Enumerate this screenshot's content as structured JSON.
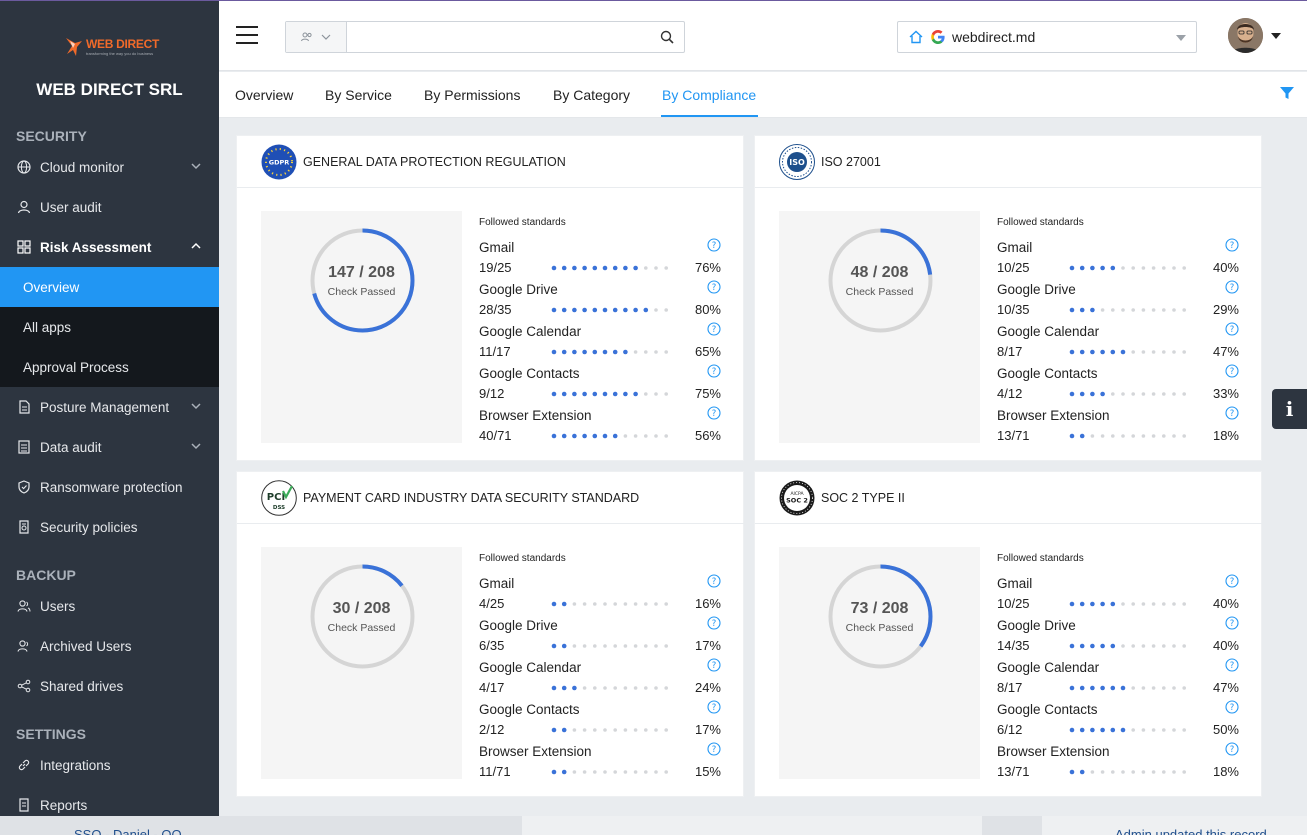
{
  "company": "WEB DIRECT SRL",
  "logo": {
    "wordmark": "WEB DIRECT",
    "tagline": "transforming the way you do business"
  },
  "sidebar": {
    "sections": [
      "SECURITY",
      "BACKUP",
      "SETTINGS"
    ],
    "items": [
      {
        "label": "Cloud monitor",
        "icon": "globe-icon"
      },
      {
        "label": "User audit",
        "icon": "user-icon"
      },
      {
        "label": "Risk Assessment",
        "icon": "grid-icon"
      },
      {
        "label": "Overview"
      },
      {
        "label": "All apps"
      },
      {
        "label": "Approval Process"
      },
      {
        "label": "Posture Management",
        "icon": "document-icon"
      },
      {
        "label": "Data audit",
        "icon": "list-icon"
      },
      {
        "label": "Ransomware protection",
        "icon": "shield-icon"
      },
      {
        "label": "Security policies",
        "icon": "policy-icon"
      },
      {
        "label": "Users",
        "icon": "users-icon"
      },
      {
        "label": "Archived Users",
        "icon": "archived-users-icon"
      },
      {
        "label": "Shared drives",
        "icon": "share-icon"
      },
      {
        "label": "Integrations",
        "icon": "link-icon"
      },
      {
        "label": "Reports",
        "icon": "report-icon"
      }
    ]
  },
  "header": {
    "search_value": "",
    "domain": "webdirect.md"
  },
  "tabs": [
    "Overview",
    "By Service",
    "By Permissions",
    "By Category",
    "By Compliance"
  ],
  "active_tab": "By Compliance",
  "colors": {
    "accent": "#2196f3",
    "sidebar": "#2d3540",
    "progress": "#3a72d8",
    "track": "#d5d5d5"
  },
  "cards": [
    {
      "title": "GENERAL DATA PROTECTION REGULATION",
      "badge": "GDPR",
      "gauge": {
        "text": "147 / 208",
        "label": "Check Passed",
        "passed": 147,
        "total": 208
      },
      "std_head": "Followed standards",
      "services": [
        {
          "name": "Gmail",
          "count": "19/25",
          "pct": "76%",
          "value": 0.76
        },
        {
          "name": "Google Drive",
          "count": "28/35",
          "pct": "80%",
          "value": 0.8
        },
        {
          "name": "Google Calendar",
          "count": "11/17",
          "pct": "65%",
          "value": 0.65
        },
        {
          "name": "Google Contacts",
          "count": "9/12",
          "pct": "75%",
          "value": 0.75
        },
        {
          "name": "Browser Extension",
          "count": "40/71",
          "pct": "56%",
          "value": 0.56
        }
      ]
    },
    {
      "title": "ISO 27001",
      "badge": "ISO",
      "gauge": {
        "text": "48 / 208",
        "label": "Check Passed",
        "passed": 48,
        "total": 208
      },
      "std_head": "Followed standards",
      "services": [
        {
          "name": "Gmail",
          "count": "10/25",
          "pct": "40%",
          "value": 0.4
        },
        {
          "name": "Google Drive",
          "count": "10/35",
          "pct": "29%",
          "value": 0.29
        },
        {
          "name": "Google Calendar",
          "count": "8/17",
          "pct": "47%",
          "value": 0.47
        },
        {
          "name": "Google Contacts",
          "count": "4/12",
          "pct": "33%",
          "value": 0.33
        },
        {
          "name": "Browser Extension",
          "count": "13/71",
          "pct": "18%",
          "value": 0.18
        }
      ]
    },
    {
      "title": "PAYMENT CARD INDUSTRY DATA SECURITY STANDARD",
      "badge": "PCI DSS",
      "gauge": {
        "text": "30 / 208",
        "label": "Check Passed",
        "passed": 30,
        "total": 208
      },
      "std_head": "Followed standards",
      "services": [
        {
          "name": "Gmail",
          "count": "4/25",
          "pct": "16%",
          "value": 0.16
        },
        {
          "name": "Google Drive",
          "count": "6/35",
          "pct": "17%",
          "value": 0.17
        },
        {
          "name": "Google Calendar",
          "count": "4/17",
          "pct": "24%",
          "value": 0.24
        },
        {
          "name": "Google Contacts",
          "count": "2/12",
          "pct": "17%",
          "value": 0.17
        },
        {
          "name": "Browser Extension",
          "count": "11/71",
          "pct": "15%",
          "value": 0.15
        }
      ]
    },
    {
      "title": "SOC 2 TYPE II",
      "badge": "AICPA SOC 2",
      "gauge": {
        "text": "73 / 208",
        "label": "Check Passed",
        "passed": 73,
        "total": 208
      },
      "std_head": "Followed standards",
      "services": [
        {
          "name": "Gmail",
          "count": "10/25",
          "pct": "40%",
          "value": 0.4
        },
        {
          "name": "Google Drive",
          "count": "14/35",
          "pct": "40%",
          "value": 0.4
        },
        {
          "name": "Google Calendar",
          "count": "8/17",
          "pct": "47%",
          "value": 0.47
        },
        {
          "name": "Google Contacts",
          "count": "6/12",
          "pct": "50%",
          "value": 0.5
        },
        {
          "name": "Browser Extension",
          "count": "13/71",
          "pct": "18%",
          "value": 0.18
        }
      ]
    }
  ],
  "underlay": {
    "left_text": "SSO - Daniel - OO",
    "right_text": "Admin updated this record."
  }
}
